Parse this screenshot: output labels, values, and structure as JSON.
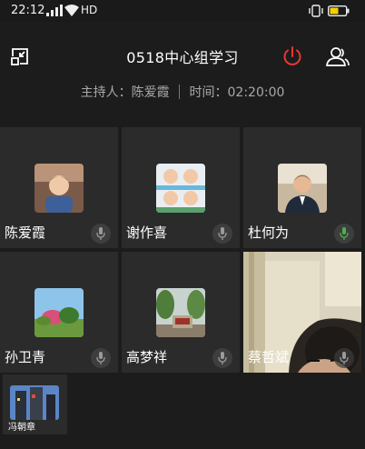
{
  "status": {
    "time": "22:12",
    "network": "HD",
    "icons": [
      "signal-icon",
      "wifi-icon",
      "vibrate-icon",
      "battery-icon"
    ]
  },
  "header": {
    "title": "0518中心组学习",
    "host_label": "主持人：",
    "host_name": "陈爱霞",
    "time_label": "时间：",
    "time_value": "02:20:00",
    "icons": [
      "minimize-window-icon",
      "power-icon",
      "members-icon"
    ],
    "power_color": "#e53935"
  },
  "participants": [
    {
      "name": "陈爱霞",
      "mic_active": false
    },
    {
      "name": "谢作喜",
      "mic_active": false
    },
    {
      "name": "杜何为",
      "mic_active": true
    },
    {
      "name": "孙卫青",
      "mic_active": false
    },
    {
      "name": "高梦祥",
      "mic_active": false
    },
    {
      "name": "蔡哲斌",
      "mic_active": false
    }
  ],
  "thumbnail": {
    "name": "冯朝章"
  },
  "colors": {
    "mic_active": "#4caf50",
    "mic_idle": "#9a9a9a"
  }
}
